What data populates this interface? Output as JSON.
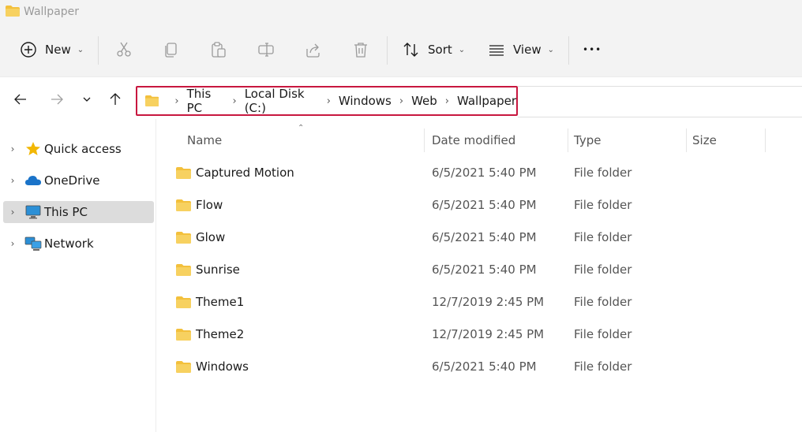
{
  "window": {
    "title": "Wallpaper"
  },
  "toolbar": {
    "new_label": "New",
    "sort_label": "Sort",
    "view_label": "View",
    "more_label": "•••"
  },
  "breadcrumb": [
    "This PC",
    "Local Disk (C:)",
    "Windows",
    "Web",
    "Wallpaper"
  ],
  "sidebar": {
    "items": [
      {
        "label": "Quick access"
      },
      {
        "label": "OneDrive"
      },
      {
        "label": "This PC"
      },
      {
        "label": "Network"
      }
    ]
  },
  "columns": {
    "name": "Name",
    "date": "Date modified",
    "type": "Type",
    "size": "Size"
  },
  "files": [
    {
      "name": "Captured Motion",
      "date": "6/5/2021 5:40 PM",
      "type": "File folder"
    },
    {
      "name": "Flow",
      "date": "6/5/2021 5:40 PM",
      "type": "File folder"
    },
    {
      "name": "Glow",
      "date": "6/5/2021 5:40 PM",
      "type": "File folder"
    },
    {
      "name": "Sunrise",
      "date": "6/5/2021 5:40 PM",
      "type": "File folder"
    },
    {
      "name": "Theme1",
      "date": "12/7/2019 2:45 PM",
      "type": "File folder"
    },
    {
      "name": "Theme2",
      "date": "12/7/2019 2:45 PM",
      "type": "File folder"
    },
    {
      "name": "Windows",
      "date": "6/5/2021 5:40 PM",
      "type": "File folder"
    }
  ],
  "colors": {
    "highlight": "#c8173f",
    "folder": "#f3c03c",
    "selection": "#dcdcdc"
  }
}
